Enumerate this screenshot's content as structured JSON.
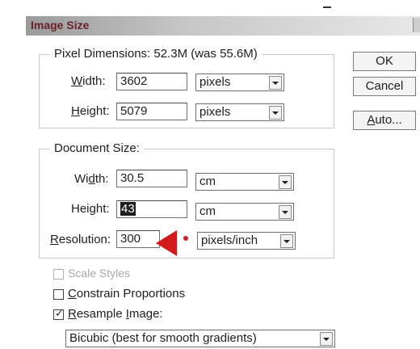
{
  "dialog": {
    "title": "Image Size"
  },
  "pixel_dimensions": {
    "legend": "Pixel Dimensions:  52.3M (was 55.6M)",
    "width": {
      "label_pre": "",
      "label_u": "W",
      "label_post": "idth:",
      "value": "3602",
      "unit": "pixels"
    },
    "height": {
      "label_pre": "",
      "label_u": "H",
      "label_post": "eight:",
      "value": "5079",
      "unit": "pixels"
    }
  },
  "document_size": {
    "legend": "Document Size:",
    "width": {
      "label_pre": "Wi",
      "label_u": "d",
      "label_post": "th:",
      "value": "30.5",
      "unit": "cm"
    },
    "height": {
      "label_pre": "Hei",
      "label_u": "g",
      "label_post": "ht:",
      "value": "43",
      "unit": "cm"
    },
    "resolution": {
      "label_pre": "",
      "label_u": "R",
      "label_post": "esolution:",
      "value": "300",
      "unit": "pixels/inch"
    }
  },
  "buttons": {
    "ok": "OK",
    "cancel": "Cancel",
    "auto_pre": "",
    "auto_u": "A",
    "auto_post": "uto..."
  },
  "options": {
    "scale_styles": {
      "label": "Scale Styles",
      "checked": false,
      "enabled": false
    },
    "constrain": {
      "label_u": "C",
      "label_post": "onstrain Proportions",
      "checked": false
    },
    "resample": {
      "label_u": "R",
      "label_mid": "esample ",
      "label_u2": "I",
      "label_post": "mage:",
      "checked": true,
      "check_glyph": "✓"
    }
  },
  "resample_method": "Bicubic (best for smooth gradients)",
  "colors": {
    "annotation_red": "#d41a1a",
    "title_text": "#6a1f2a"
  },
  "icons": [
    "dropdown-arrow-icon",
    "annotation-arrow-icon",
    "annotation-dot-icon",
    "checkmark-icon"
  ]
}
